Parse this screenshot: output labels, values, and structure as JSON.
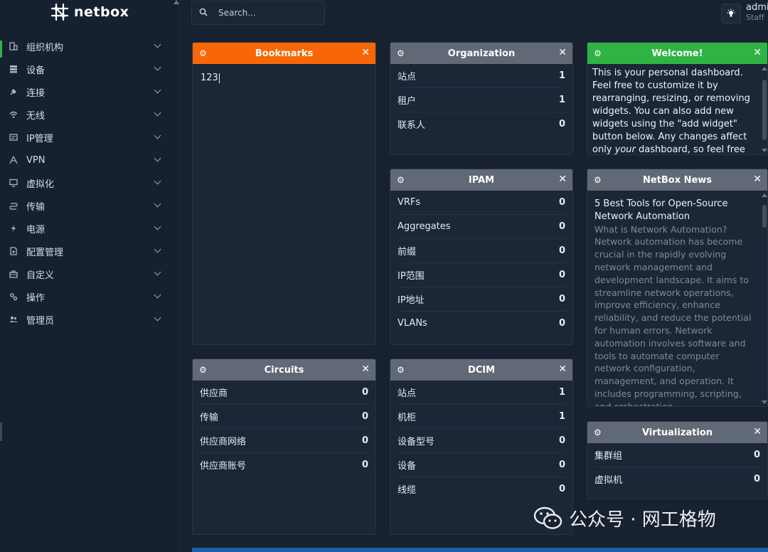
{
  "brand": {
    "name": "netbox"
  },
  "search": {
    "placeholder": "Search..."
  },
  "user": {
    "name": "admin",
    "role": "Staff"
  },
  "sidebar": {
    "items": [
      {
        "label": "组织机构",
        "icon": "building-icon"
      },
      {
        "label": "设备",
        "icon": "server-icon"
      },
      {
        "label": "连接",
        "icon": "plug-icon"
      },
      {
        "label": "无线",
        "icon": "wifi-icon"
      },
      {
        "label": "IP管理",
        "icon": "ip-icon"
      },
      {
        "label": "VPN",
        "icon": "tunnel-icon"
      },
      {
        "label": "虚拟化",
        "icon": "monitor-icon"
      },
      {
        "label": "传输",
        "icon": "transit-icon"
      },
      {
        "label": "电源",
        "icon": "power-icon"
      },
      {
        "label": "配置管理",
        "icon": "file-cog-icon"
      },
      {
        "label": "自定义",
        "icon": "toolbox-icon"
      },
      {
        "label": "操作",
        "icon": "cogs-icon"
      },
      {
        "label": "管理员",
        "icon": "users-icon"
      }
    ]
  },
  "widgets": {
    "bookmarks": {
      "title": "Bookmarks",
      "text": "123"
    },
    "organization": {
      "title": "Organization",
      "rows": [
        {
          "label": "站点",
          "count": "1"
        },
        {
          "label": "租户",
          "count": "1"
        },
        {
          "label": "联系人",
          "count": "0"
        }
      ]
    },
    "welcome": {
      "title": "Welcome!",
      "text_before": "This is your personal dashboard. Feel free to customize it by rearranging, resizing, or removing widgets. You can also add new widgets using the \"add widget\" button below. Any changes affect only ",
      "text_em": "your",
      "text_after": " dashboard, so feel free to experiment!"
    },
    "ipam": {
      "title": "IPAM",
      "rows": [
        {
          "label": "VRFs",
          "count": "0"
        },
        {
          "label": "Aggregates",
          "count": "0"
        },
        {
          "label": "前缀",
          "count": "0"
        },
        {
          "label": "IP范围",
          "count": "0"
        },
        {
          "label": "IP地址",
          "count": "0"
        },
        {
          "label": "VLANs",
          "count": "0"
        }
      ]
    },
    "news": {
      "title": "NetBox News",
      "headline": "5 Best Tools for Open-Source Network Automation",
      "summary": "What is Network Automation? Network automation has become crucial in the rapidly evolving network management and development landscape. It aims to streamline network operations, improve efficiency, enhance reliability, and reduce the potential for human errors. Network automation involves software and tools to automate computer network configuration, management, and operation. It includes programming, scripting, and orchestration..."
    },
    "circuits": {
      "title": "Circuits",
      "rows": [
        {
          "label": "供应商",
          "count": "0"
        },
        {
          "label": "传输",
          "count": "0"
        },
        {
          "label": "供应商网络",
          "count": "0"
        },
        {
          "label": "供应商账号",
          "count": "0"
        }
      ]
    },
    "dcim": {
      "title": "DCIM",
      "rows": [
        {
          "label": "站点",
          "count": "1"
        },
        {
          "label": "机柜",
          "count": "1"
        },
        {
          "label": "设备型号",
          "count": "0"
        },
        {
          "label": "设备",
          "count": "0"
        },
        {
          "label": "线缆",
          "count": "0"
        }
      ]
    },
    "virtualization": {
      "title": "Virtualization",
      "rows": [
        {
          "label": "集群组",
          "count": "0"
        },
        {
          "label": "虚拟机",
          "count": "0"
        }
      ]
    }
  },
  "watermark": {
    "text": "公众号 · 网工格物"
  },
  "colors": {
    "background": "#17212f",
    "sidebar": "#162130",
    "card": "#1b2637",
    "header_orange": "#f76707",
    "header_gray": "#616876",
    "header_green": "#2fb344",
    "accent_blue": "#1f5fa8"
  }
}
